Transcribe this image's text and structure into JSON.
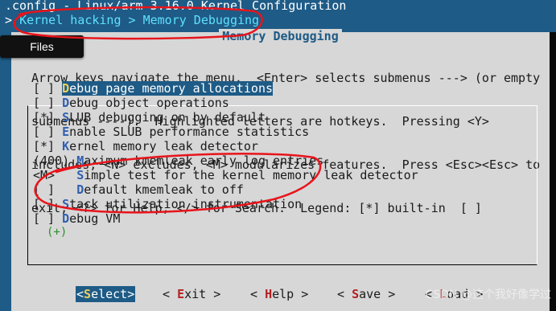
{
  "terminal": {
    "title": ".config - Linux/arm 3.16.0 Kernel Configuration",
    "breadcrumb_prefix": "> ",
    "breadcrumb": "Kernel hacking > Memory Debugging"
  },
  "tooltip": {
    "label": "Files"
  },
  "dialog": {
    "title": "Memory Debugging",
    "help_lines": [
      "Arrow keys navigate the menu.  <Enter> selects submenus ---> (or empty",
      "submenus ----).  Highlighted letters are hotkeys.  Pressing <Y>",
      "includes, <N> excludes, <M> modularizes features.  Press <Esc><Esc> to",
      "exit, <?> for Help, </> for Search.  Legend: [*] built-in  [ ]"
    ]
  },
  "menu": [
    {
      "prefix": "[ ] ",
      "hot": "D",
      "rest": "ebug page memory allocations",
      "selected": true
    },
    {
      "prefix": "[ ] ",
      "hot": "D",
      "rest": "ebug object operations",
      "selected": false
    },
    {
      "prefix": "[*] ",
      "hot": "S",
      "rest": "LUB debugging on by default",
      "selected": false
    },
    {
      "prefix": "[ ] ",
      "hot": "E",
      "rest": "nable SLUB performance statistics",
      "selected": false
    },
    {
      "prefix": "[*] ",
      "hot": "K",
      "rest": "ernel memory leak detector",
      "selected": false
    },
    {
      "prefix": "(400) ",
      "hot": "M",
      "rest": "aximum kmemleak early log entries",
      "selected": false
    },
    {
      "prefix": "<M>   ",
      "hot": "S",
      "rest": "imple test for the kernel memory leak detector",
      "selected": false
    },
    {
      "prefix": "[ ]   ",
      "hot": "D",
      "rest": "efault kmemleak to off",
      "selected": false
    },
    {
      "prefix": "[ ] ",
      "hot": "S",
      "rest": "tack utilization instrumentation",
      "selected": false
    },
    {
      "prefix": "[ ] ",
      "hot": "D",
      "rest": "ebug VM",
      "selected": false
    }
  ],
  "more_indicator": "(+)",
  "buttons": {
    "select": {
      "open": "<",
      "hot": "S",
      "rest": "elect>"
    },
    "exit": {
      "open": "< ",
      "hot": "E",
      "rest": "xit >"
    },
    "help": {
      "open": "< ",
      "hot": "H",
      "rest": "elp >"
    },
    "save": {
      "open": "< ",
      "hot": "S",
      "rest": "ave >"
    },
    "load": {
      "open": "< ",
      "hot": "L",
      "rest": "oad >"
    }
  },
  "watermark": "CSDN @这个我好像学过",
  "colors": {
    "background": "#1e5b86",
    "dialog": "#d7d7d7",
    "annotation": "#e8141b"
  }
}
